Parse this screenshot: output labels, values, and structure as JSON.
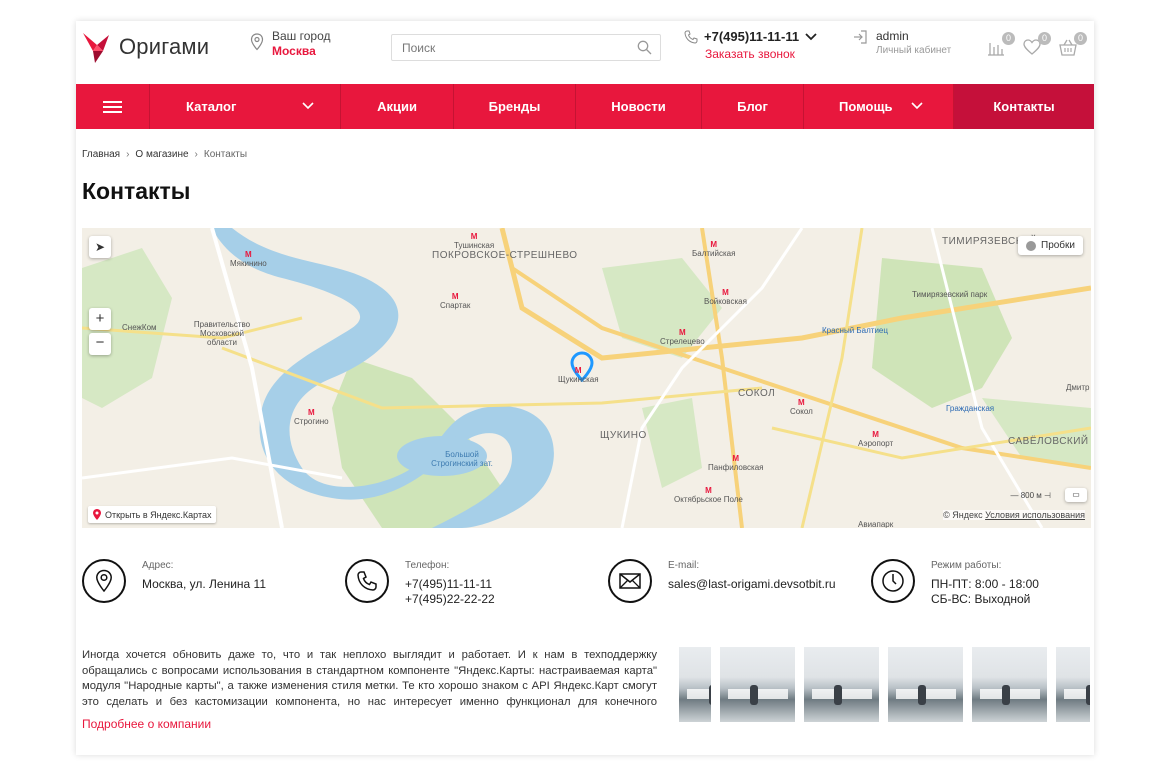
{
  "header": {
    "logo_text": "Оригами",
    "city_label": "Ваш город",
    "city_name": "Москва",
    "search_placeholder": "Поиск",
    "phone": "+7(495)11-11-11",
    "callback": "Заказать звонок",
    "user_name": "admin",
    "user_sub": "Личный кабинет",
    "compare_count": "0",
    "favorites_count": "0",
    "cart_count": "0",
    "accent_color": "#e8173d"
  },
  "nav": {
    "items": [
      {
        "label": "Каталог"
      },
      {
        "label": "Акции"
      },
      {
        "label": "Бренды"
      },
      {
        "label": "Новости"
      },
      {
        "label": "Блог"
      },
      {
        "label": "Помощь"
      },
      {
        "label": "Контакты"
      }
    ]
  },
  "breadcrumb": [
    "Главная",
    "О магазине",
    "Контакты"
  ],
  "page_title": "Контакты",
  "map": {
    "traffic": "Пробки",
    "open_link": "Открыть в Яндекс.Картах",
    "copyright": "© Яндекс",
    "terms": "Условия использования",
    "scale": "800 м",
    "labels": [
      "Тушинская",
      "ПОКРОВСКОЕ-СТРЕШНЕВО",
      "Балтийская",
      "ТИМИРЯЗЕВСКИЙ",
      "Мякинино",
      "Спартак",
      "Войковская",
      "Тимирязевский парк",
      "СнежКом",
      "Правительство Московской области",
      "Красный Балтиец",
      "Стрелецево",
      "Щукинская",
      "СОКОЛ",
      "Сокол",
      "Строгино",
      "Большой Строгинский зат.",
      "ЩУКИНО",
      "Аэропорт",
      "САВЁЛОВСКИЙ",
      "Панфиловская",
      "Октябрьское Поле",
      "Авиапарк",
      "Гражданская",
      "Дмитр"
    ]
  },
  "contacts": {
    "address_label": "Адрес:",
    "address": "Москва, ул. Ленина 11",
    "phone_label": "Телефон:",
    "phone1": "+7(495)11-11-11",
    "phone2": "+7(495)22-22-22",
    "email_label": "E-mail:",
    "email": "sales@last-origami.devsotbit.ru",
    "hours_label": "Режим работы:",
    "hours1": "ПН-ПТ: 8:00 - 18:00",
    "hours2": "СБ-ВС: Выходной"
  },
  "about": {
    "text": "Иногда хочется обновить даже то, что и так неплохо выглядит и работает. И к нам в техподдержку обращались с вопросами использования в стандартном компоненте \"Яндекс.Карты: настраиваемая карта\" модуля \"Народные карты\", а также изменения стиля метки. Те кто хорошо знаком с API Яндекс.Карт смогут это сделать и без кастомизации компонента, но нас интересует именно функционал для конечного пользователя,",
    "more_link": "Подробнее о компании"
  }
}
